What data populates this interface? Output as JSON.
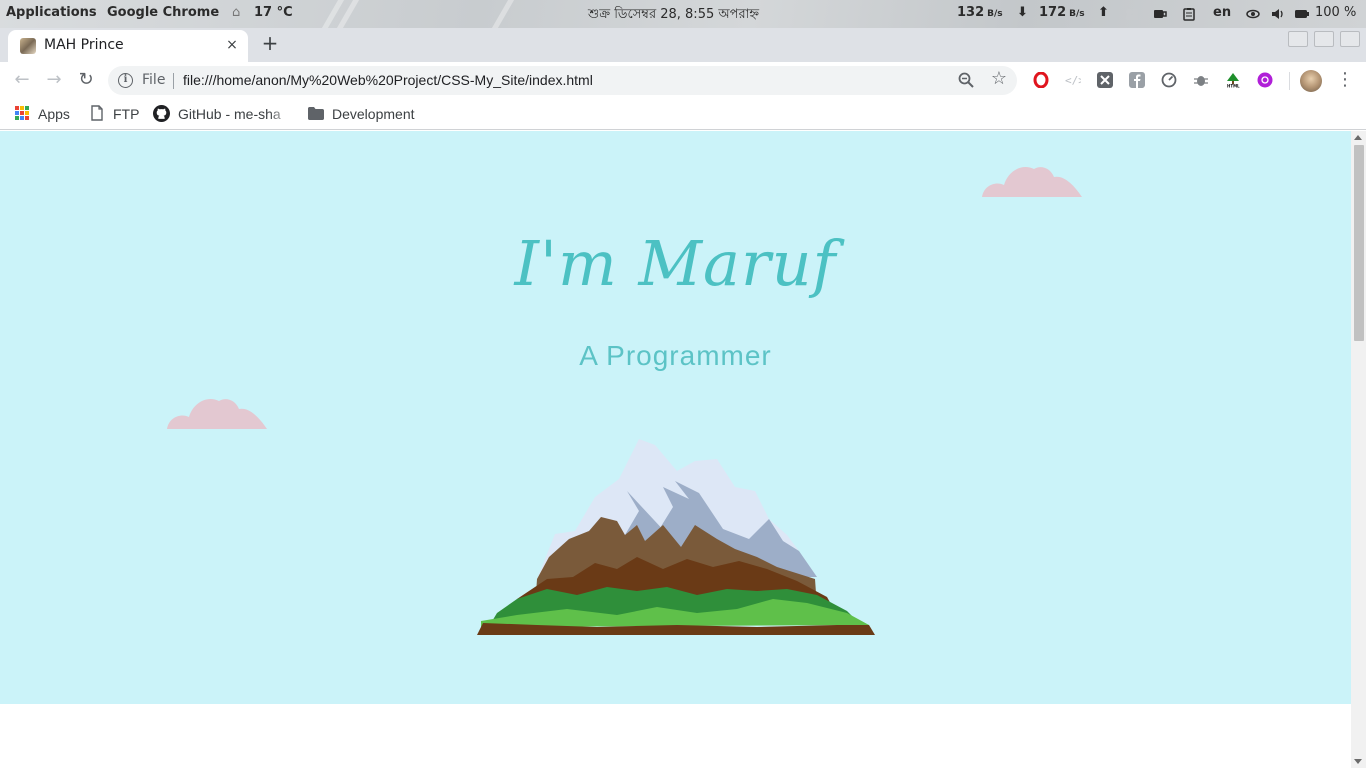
{
  "system_panel": {
    "applications": "Applications",
    "active_app": "Google Chrome",
    "weather": "17 °C",
    "clock": "শুক্র ডিসেম্বর 28, 8:55 অপরাহ্ন",
    "net_down": "132",
    "net_down_unit": "B/s",
    "net_up": "172",
    "net_up_unit": "B/s",
    "language": "en",
    "battery": "100 %"
  },
  "browser": {
    "tab_title": "MAH Prince",
    "tab_close": "×",
    "new_tab": "+",
    "omnibox": {
      "scheme_label": "File",
      "url": "file:///home/anon/My%20Web%20Project/CSS-My_Site/index.html"
    },
    "bookmarks": [
      {
        "label": "Apps"
      },
      {
        "label": "FTP"
      },
      {
        "label": "GitHub - me-sha"
      },
      {
        "label": "Development"
      }
    ]
  },
  "page": {
    "title": "I'm Maruf",
    "subtitle": "A Programmer"
  },
  "colors": {
    "hero_bg": "#cbf3f9",
    "accent": "#4cc1c3",
    "cloud": "#e3c8d1"
  }
}
